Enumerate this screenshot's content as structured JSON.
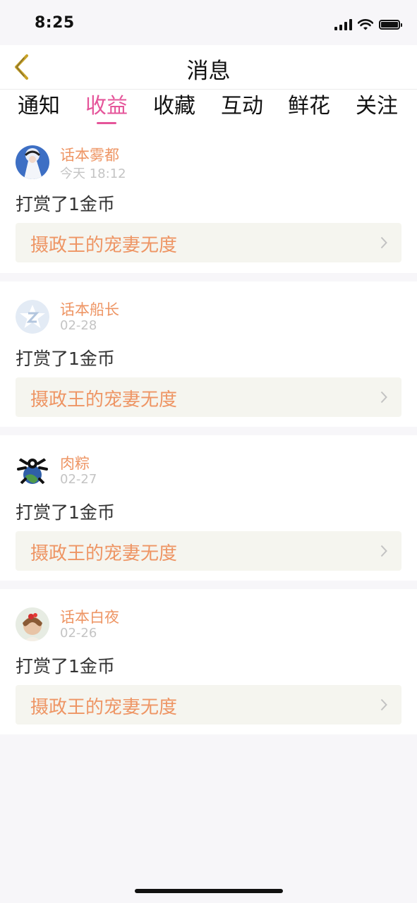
{
  "status_bar": {
    "time": "8:25"
  },
  "header": {
    "title": "消息"
  },
  "tabs": [
    {
      "label": "通知"
    },
    {
      "label": "收益",
      "active": true
    },
    {
      "label": "收藏"
    },
    {
      "label": "互动"
    },
    {
      "label": "鲜花"
    },
    {
      "label": "关注"
    }
  ],
  "messages": [
    {
      "user": "话本雾都",
      "time": "今天 18:12",
      "action": "打赏了1金币",
      "book": "摄政王的宠妻无度"
    },
    {
      "user": "话本船长",
      "time": "02-28",
      "action": "打赏了1金币",
      "book": "摄政王的宠妻无度"
    },
    {
      "user": "肉粽",
      "time": "02-27",
      "action": "打赏了1金币",
      "book": "摄政王的宠妻无度"
    },
    {
      "user": "话本白夜",
      "time": "02-26",
      "action": "打赏了1金币",
      "book": "摄政王的宠妻无度"
    }
  ],
  "colors": {
    "accent": "#e5559a",
    "name": "#ee9564",
    "back_arrow": "#c8a227",
    "book_bg": "#f5f5ef"
  }
}
